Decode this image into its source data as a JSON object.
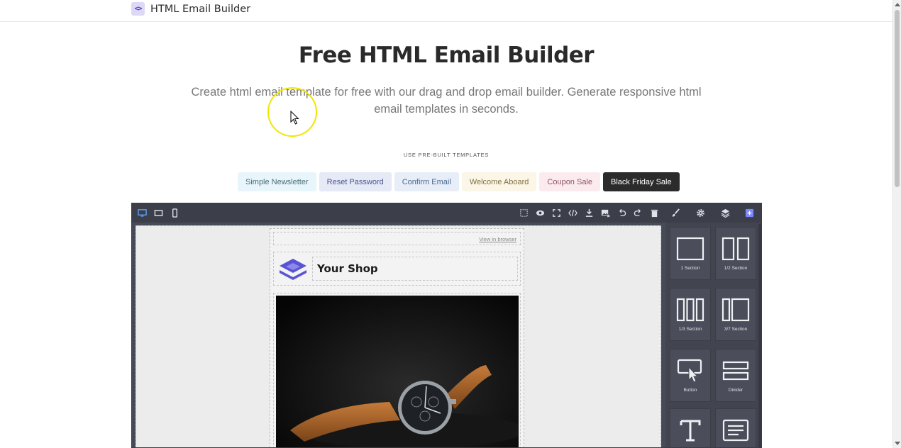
{
  "nav": {
    "brand": "HTML Email Builder",
    "brand_icon": "code-icon"
  },
  "hero": {
    "title": "Free HTML Email Builder",
    "subtitle": "Create html email template for free with our drag and drop email builder. Generate responsive html email templates in seconds."
  },
  "templates": {
    "label": "USE PRE-BUILT TEMPLATES",
    "items": [
      {
        "label": "Simple Newsletter",
        "bg": "#e8f6fb",
        "fg": "#4a6b78"
      },
      {
        "label": "Reset Password",
        "bg": "#e6e9f6",
        "fg": "#4a5690"
      },
      {
        "label": "Confirm Email",
        "bg": "#e7eef8",
        "fg": "#4a6790"
      },
      {
        "label": "Welcome Aboard",
        "bg": "#fbf6e7",
        "fg": "#80703f"
      },
      {
        "label": "Coupon Sale",
        "bg": "#fcebee",
        "fg": "#8e5560"
      },
      {
        "label": "Black Friday Sale",
        "bg": "#2b2b2b",
        "fg": "#ffffff"
      }
    ]
  },
  "editor": {
    "device_icons": [
      "desktop-icon",
      "tablet-icon",
      "mobile-icon"
    ],
    "tool_icons": [
      "sw-visibility-icon",
      "preview-icon",
      "fullscreen-icon",
      "code-icon",
      "download-icon",
      "image-remove-icon",
      "undo-icon",
      "redo-icon",
      "trash-icon"
    ],
    "panel_icons": [
      "brush-icon",
      "gear-icon",
      "layers-icon",
      "blocks-icon"
    ],
    "email": {
      "view_in_browser": "View in browser",
      "shop_name": "Your Shop",
      "logo_color": "#5a53d4"
    },
    "blocks": [
      {
        "label": "1 Section"
      },
      {
        "label": "1/2 Section"
      },
      {
        "label": "1/3 Section"
      },
      {
        "label": "3/7 Section"
      },
      {
        "label": "Button"
      },
      {
        "label": "Divider"
      },
      {
        "label": ""
      },
      {
        "label": ""
      }
    ]
  }
}
